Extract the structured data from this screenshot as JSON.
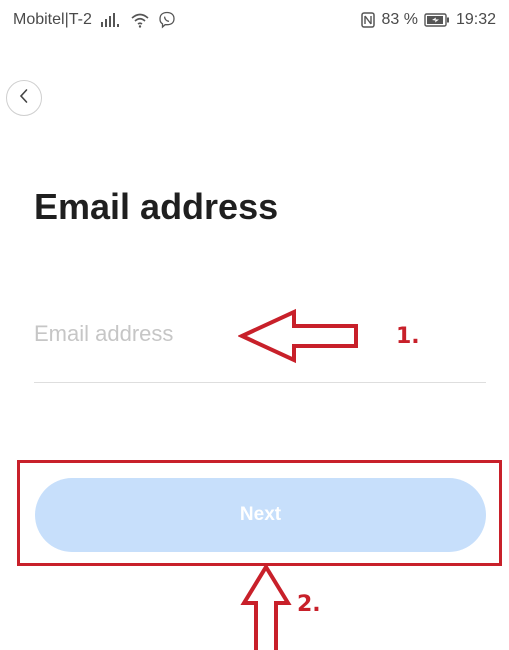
{
  "status_bar": {
    "carrier": "Mobitel|T-2",
    "battery": "83 %",
    "time": "19:32",
    "icons": [
      "signal-icon",
      "wifi-icon",
      "viber-icon",
      "nfc-icon",
      "battery-icon"
    ]
  },
  "nav": {
    "back_icon": "chevron-left-icon"
  },
  "page": {
    "title": "Email address"
  },
  "email_field": {
    "value": "",
    "placeholder": "Email address"
  },
  "next_button": {
    "label": "Next",
    "background": "#c7dffb",
    "text_color": "#ffffff"
  },
  "annotations": {
    "step1_label": "1.",
    "step2_label": "2.",
    "color": "#c8202a"
  }
}
